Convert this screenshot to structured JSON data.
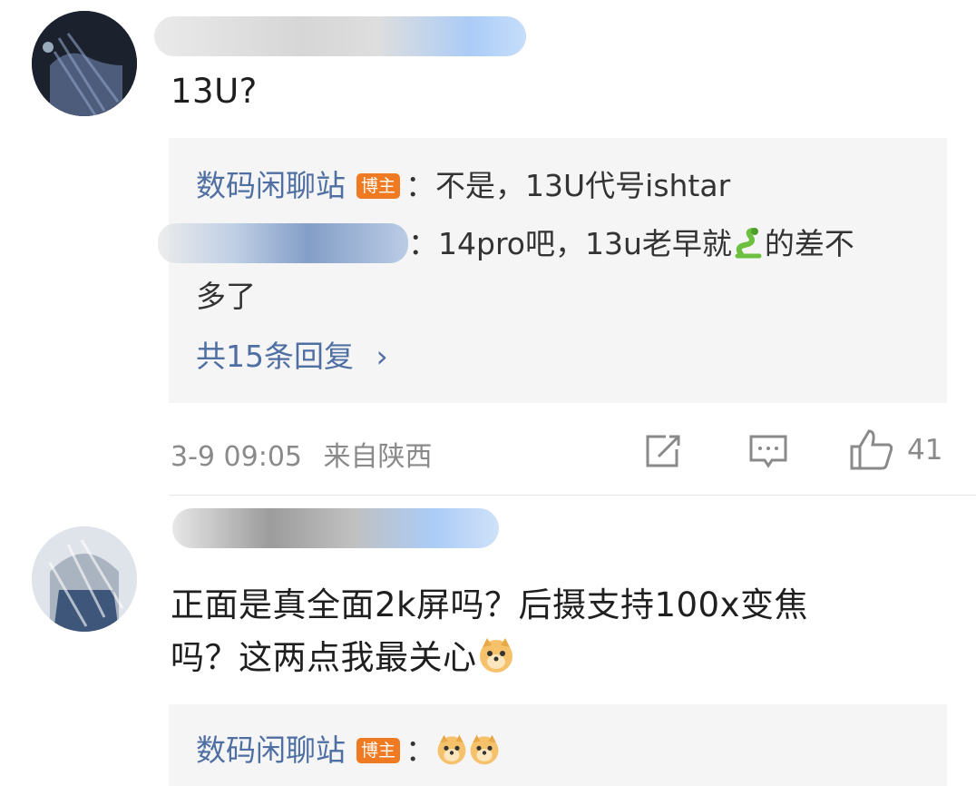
{
  "comments": [
    {
      "text": "13U?",
      "replies": [
        {
          "author": "数码闲聊站",
          "badge": "博主",
          "sep": "：",
          "text": "不是，13U代号ishtar"
        },
        {
          "text_before_emoji": "：14pro吧，13u老早就",
          "text_after_emoji": "的差不",
          "text_line2": "多了"
        }
      ],
      "more_replies": "共15条回复",
      "more_arrow": "›",
      "time": "3-9 09:05",
      "location": "来自陕西",
      "like_count": "41",
      "icons": [
        "share-icon",
        "comment-icon",
        "like-icon"
      ]
    },
    {
      "text_line1": "正面是真全面2k屏吗？后摄支持100x变焦",
      "text_line2": "吗？这两点我最关心",
      "reply": {
        "author": "数码闲聊站",
        "badge": "博主",
        "sep": "："
      }
    }
  ],
  "colors": {
    "link": "#4f6fa3",
    "badge": "#f07a22",
    "reply_bg": "#f5f5f5",
    "meta": "#8a8a8a"
  }
}
